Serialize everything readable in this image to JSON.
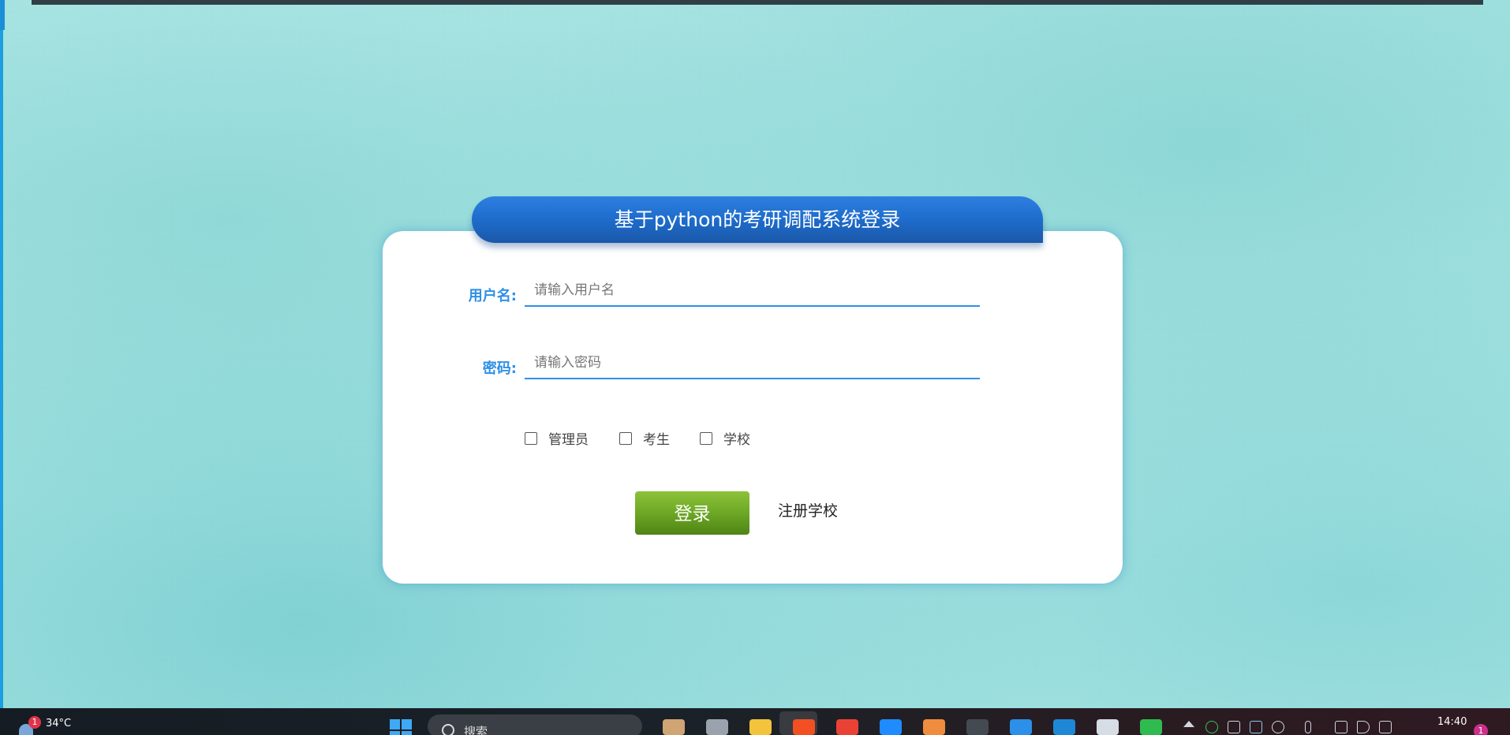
{
  "login": {
    "title": "基于python的考研调配系统登录",
    "username_label": "用户名:",
    "username_placeholder": "请输入用户名",
    "password_label": "密码:",
    "password_placeholder": "请输入密码",
    "roles": [
      {
        "label": "管理员",
        "checked": false
      },
      {
        "label": "考生",
        "checked": false
      },
      {
        "label": "学校",
        "checked": false
      }
    ],
    "login_button": "登录",
    "register_link": "注册学校"
  },
  "taskbar": {
    "weather_temp": "34°C",
    "weather_badge": "1",
    "search_text": "搜索",
    "clock_time": "14:40",
    "notification_count": "1",
    "apps": [
      {
        "name": "widgets-icon",
        "color": "#cfa574"
      },
      {
        "name": "task-view-icon",
        "color": "#9aa3ad"
      },
      {
        "name": "file-explorer-icon",
        "color": "#f2c33b"
      },
      {
        "name": "store-icon",
        "color": "#f25022"
      },
      {
        "name": "chrome-icon",
        "color": "#e94235"
      },
      {
        "name": "pycharm-icon",
        "color": "#1f8bff"
      },
      {
        "name": "copilot-icon",
        "color": "#f08c3e"
      },
      {
        "name": "terminal-icon",
        "color": "#444a52"
      },
      {
        "name": "vscode-icon",
        "color": "#2c8fe8"
      },
      {
        "name": "edge-search-icon",
        "color": "#1e88d6"
      },
      {
        "name": "qq-icon",
        "color": "#d6dde4"
      },
      {
        "name": "wechat-icon",
        "color": "#2fbb4f"
      }
    ]
  }
}
